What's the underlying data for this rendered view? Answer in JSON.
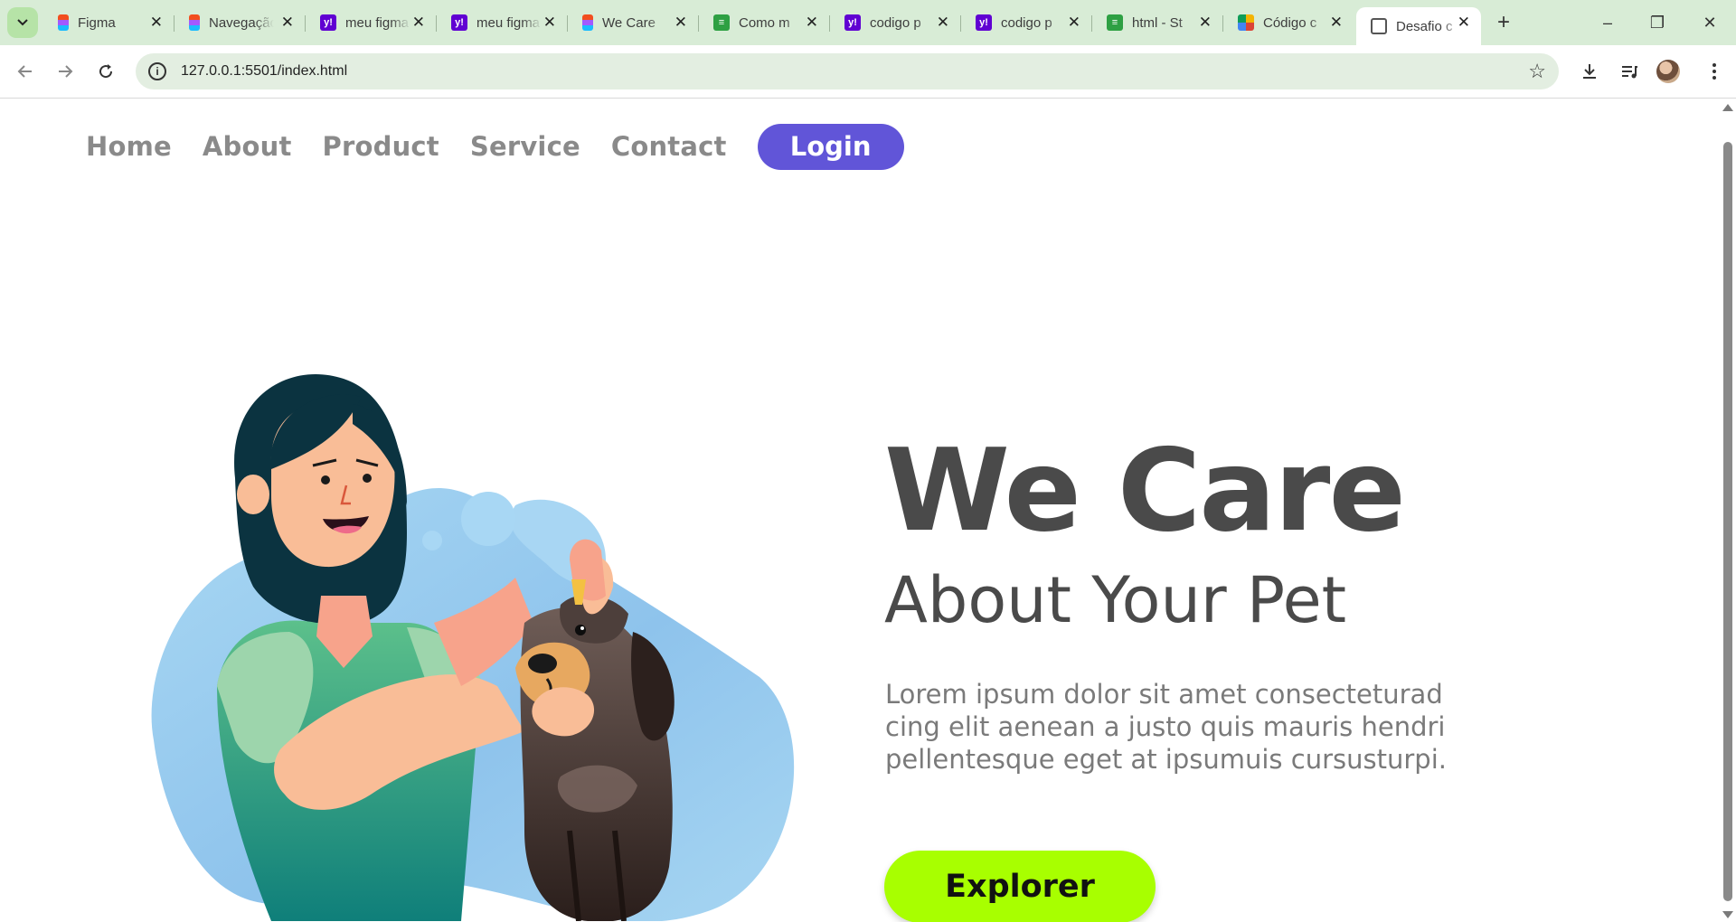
{
  "browser": {
    "tabs": [
      {
        "title": "Figma",
        "icon": "figma-icon"
      },
      {
        "title": "Navegação",
        "icon": "figma-icon"
      },
      {
        "title": "meu figma",
        "icon": "yahoo-icon"
      },
      {
        "title": "meu figma",
        "icon": "yahoo-icon"
      },
      {
        "title": "We Care",
        "icon": "figma-icon"
      },
      {
        "title": "Como m",
        "icon": "stackoverflow-icon"
      },
      {
        "title": "codigo p",
        "icon": "yahoo-icon"
      },
      {
        "title": "codigo p",
        "icon": "yahoo-icon"
      },
      {
        "title": "html - St",
        "icon": "stackoverflow-icon"
      },
      {
        "title": "Código c",
        "icon": "code-icon"
      },
      {
        "title": "Desafio c",
        "icon": "globe-icon",
        "active": true
      }
    ],
    "url": "127.0.0.1:5501/index.html",
    "accent_color": "#d8ecd6"
  },
  "site": {
    "nav": {
      "items": [
        "Home",
        "About",
        "Product",
        "Service",
        "Contact"
      ],
      "login_label": "Login"
    },
    "hero": {
      "title": "We Care",
      "subtitle": "About Your Pet",
      "text": "Lorem ipsum dolor sit amet consecteturad cing elit aenean a justo quis mauris hendri pellentesque eget at ipsumuis cursusturpi.",
      "button_label": "Explorer"
    },
    "colors": {
      "login_button": "#6155d8",
      "explorer_button": "#a8ff00",
      "heading": "#4a4a4a",
      "nav_text": "#8a8a8a"
    }
  }
}
